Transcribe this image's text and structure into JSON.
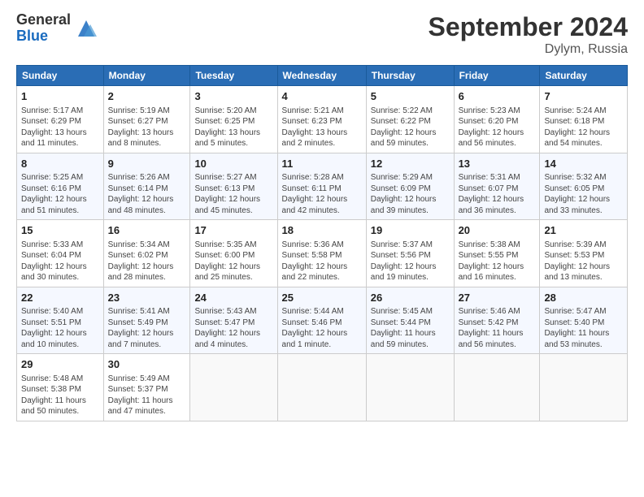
{
  "header": {
    "logo_line1": "General",
    "logo_line2": "Blue",
    "month": "September 2024",
    "location": "Dylym, Russia"
  },
  "columns": [
    "Sunday",
    "Monday",
    "Tuesday",
    "Wednesday",
    "Thursday",
    "Friday",
    "Saturday"
  ],
  "weeks": [
    [
      {
        "day": "1",
        "info": "Sunrise: 5:17 AM\nSunset: 6:29 PM\nDaylight: 13 hours and 11 minutes."
      },
      {
        "day": "2",
        "info": "Sunrise: 5:19 AM\nSunset: 6:27 PM\nDaylight: 13 hours and 8 minutes."
      },
      {
        "day": "3",
        "info": "Sunrise: 5:20 AM\nSunset: 6:25 PM\nDaylight: 13 hours and 5 minutes."
      },
      {
        "day": "4",
        "info": "Sunrise: 5:21 AM\nSunset: 6:23 PM\nDaylight: 13 hours and 2 minutes."
      },
      {
        "day": "5",
        "info": "Sunrise: 5:22 AM\nSunset: 6:22 PM\nDaylight: 12 hours and 59 minutes."
      },
      {
        "day": "6",
        "info": "Sunrise: 5:23 AM\nSunset: 6:20 PM\nDaylight: 12 hours and 56 minutes."
      },
      {
        "day": "7",
        "info": "Sunrise: 5:24 AM\nSunset: 6:18 PM\nDaylight: 12 hours and 54 minutes."
      }
    ],
    [
      {
        "day": "8",
        "info": "Sunrise: 5:25 AM\nSunset: 6:16 PM\nDaylight: 12 hours and 51 minutes."
      },
      {
        "day": "9",
        "info": "Sunrise: 5:26 AM\nSunset: 6:14 PM\nDaylight: 12 hours and 48 minutes."
      },
      {
        "day": "10",
        "info": "Sunrise: 5:27 AM\nSunset: 6:13 PM\nDaylight: 12 hours and 45 minutes."
      },
      {
        "day": "11",
        "info": "Sunrise: 5:28 AM\nSunset: 6:11 PM\nDaylight: 12 hours and 42 minutes."
      },
      {
        "day": "12",
        "info": "Sunrise: 5:29 AM\nSunset: 6:09 PM\nDaylight: 12 hours and 39 minutes."
      },
      {
        "day": "13",
        "info": "Sunrise: 5:31 AM\nSunset: 6:07 PM\nDaylight: 12 hours and 36 minutes."
      },
      {
        "day": "14",
        "info": "Sunrise: 5:32 AM\nSunset: 6:05 PM\nDaylight: 12 hours and 33 minutes."
      }
    ],
    [
      {
        "day": "15",
        "info": "Sunrise: 5:33 AM\nSunset: 6:04 PM\nDaylight: 12 hours and 30 minutes."
      },
      {
        "day": "16",
        "info": "Sunrise: 5:34 AM\nSunset: 6:02 PM\nDaylight: 12 hours and 28 minutes."
      },
      {
        "day": "17",
        "info": "Sunrise: 5:35 AM\nSunset: 6:00 PM\nDaylight: 12 hours and 25 minutes."
      },
      {
        "day": "18",
        "info": "Sunrise: 5:36 AM\nSunset: 5:58 PM\nDaylight: 12 hours and 22 minutes."
      },
      {
        "day": "19",
        "info": "Sunrise: 5:37 AM\nSunset: 5:56 PM\nDaylight: 12 hours and 19 minutes."
      },
      {
        "day": "20",
        "info": "Sunrise: 5:38 AM\nSunset: 5:55 PM\nDaylight: 12 hours and 16 minutes."
      },
      {
        "day": "21",
        "info": "Sunrise: 5:39 AM\nSunset: 5:53 PM\nDaylight: 12 hours and 13 minutes."
      }
    ],
    [
      {
        "day": "22",
        "info": "Sunrise: 5:40 AM\nSunset: 5:51 PM\nDaylight: 12 hours and 10 minutes."
      },
      {
        "day": "23",
        "info": "Sunrise: 5:41 AM\nSunset: 5:49 PM\nDaylight: 12 hours and 7 minutes."
      },
      {
        "day": "24",
        "info": "Sunrise: 5:43 AM\nSunset: 5:47 PM\nDaylight: 12 hours and 4 minutes."
      },
      {
        "day": "25",
        "info": "Sunrise: 5:44 AM\nSunset: 5:46 PM\nDaylight: 12 hours and 1 minute."
      },
      {
        "day": "26",
        "info": "Sunrise: 5:45 AM\nSunset: 5:44 PM\nDaylight: 11 hours and 59 minutes."
      },
      {
        "day": "27",
        "info": "Sunrise: 5:46 AM\nSunset: 5:42 PM\nDaylight: 11 hours and 56 minutes."
      },
      {
        "day": "28",
        "info": "Sunrise: 5:47 AM\nSunset: 5:40 PM\nDaylight: 11 hours and 53 minutes."
      }
    ],
    [
      {
        "day": "29",
        "info": "Sunrise: 5:48 AM\nSunset: 5:38 PM\nDaylight: 11 hours and 50 minutes."
      },
      {
        "day": "30",
        "info": "Sunrise: 5:49 AM\nSunset: 5:37 PM\nDaylight: 11 hours and 47 minutes."
      },
      {
        "day": "",
        "info": ""
      },
      {
        "day": "",
        "info": ""
      },
      {
        "day": "",
        "info": ""
      },
      {
        "day": "",
        "info": ""
      },
      {
        "day": "",
        "info": ""
      }
    ]
  ]
}
